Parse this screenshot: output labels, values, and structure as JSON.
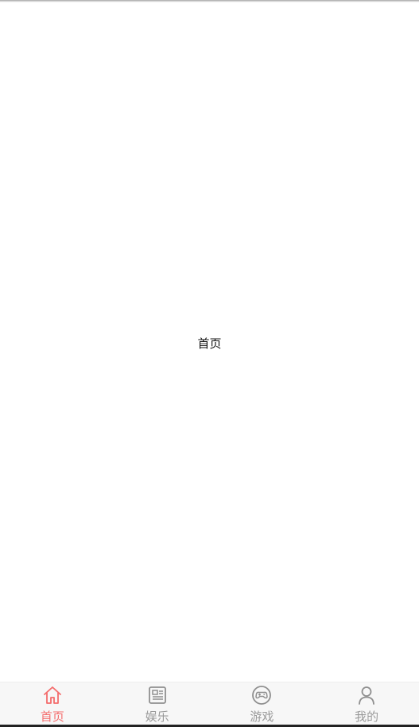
{
  "main": {
    "title": "首页"
  },
  "tabbar": {
    "active_color": "#f46c6c",
    "inactive_color": "#9a9a9a",
    "tabs": [
      {
        "label": "首页",
        "icon": "home-icon",
        "active": true
      },
      {
        "label": "娱乐",
        "icon": "news-icon",
        "active": false
      },
      {
        "label": "游戏",
        "icon": "gamepad-icon",
        "active": false
      },
      {
        "label": "我的",
        "icon": "user-icon",
        "active": false
      }
    ]
  }
}
